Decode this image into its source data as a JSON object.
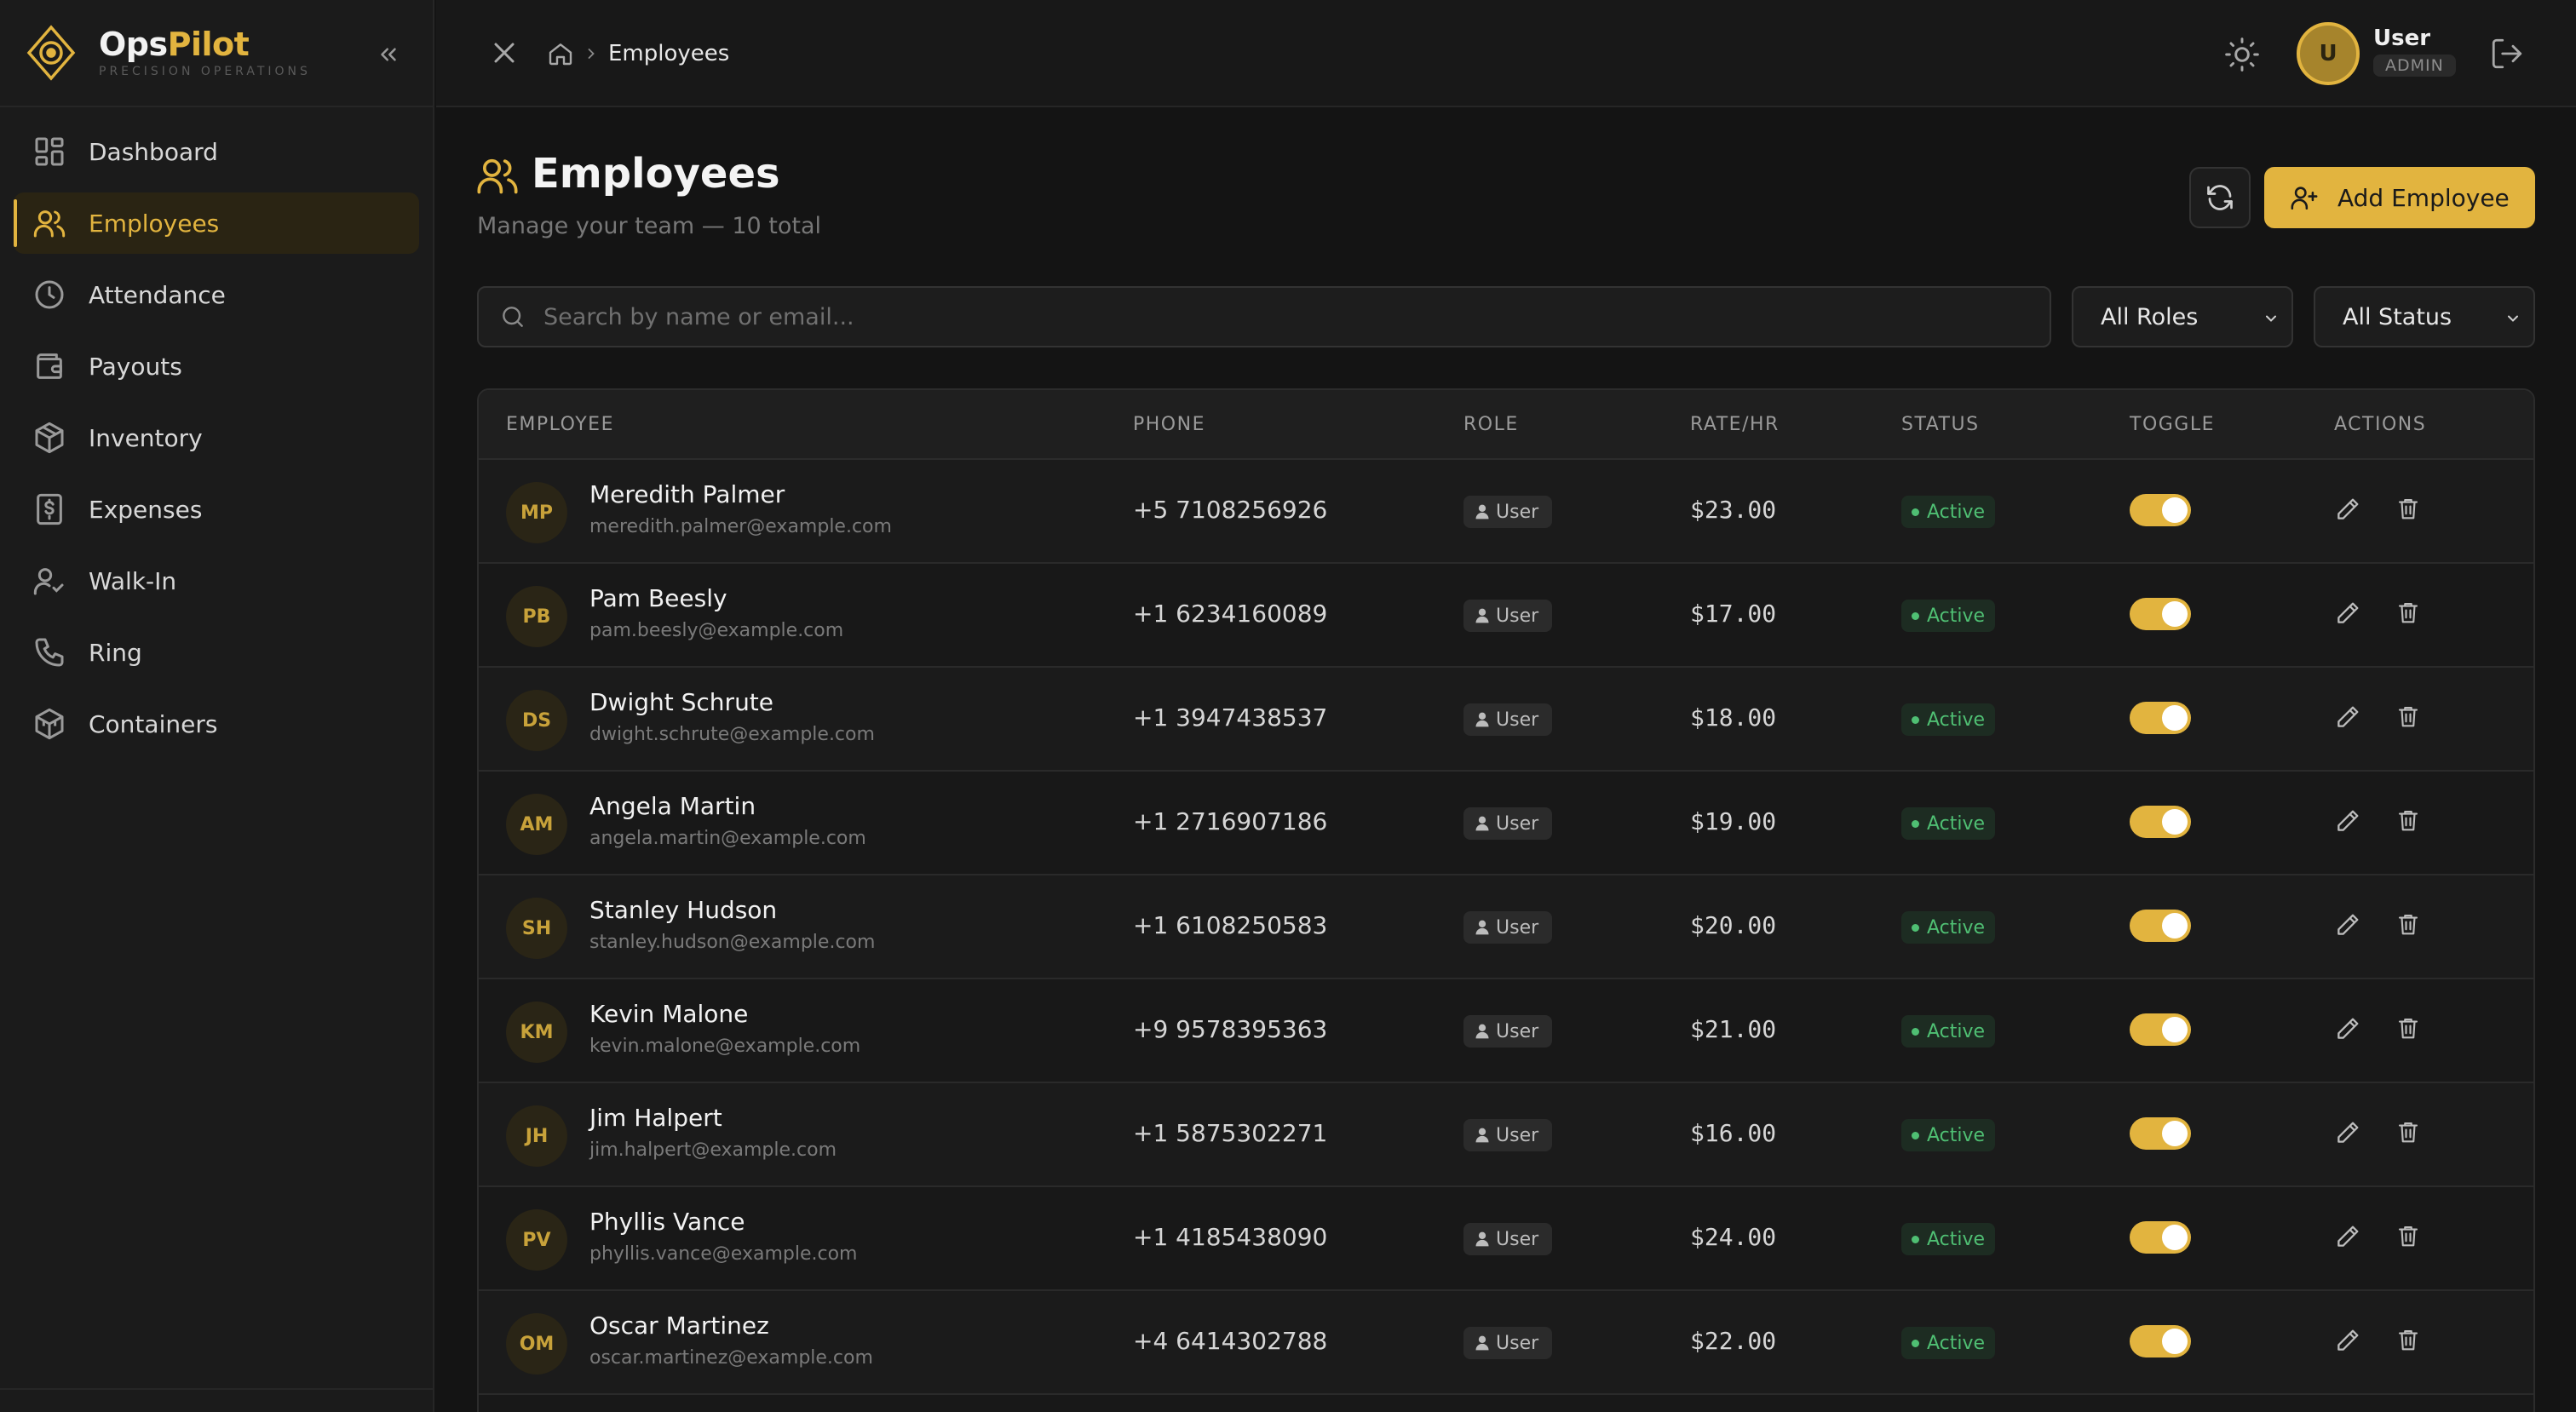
{
  "brand": {
    "name_part1": "Ops",
    "name_part2": "Pilot",
    "tagline": "PRECISION OPERATIONS",
    "accent_color": "#e2b43f",
    "logo_icon": "compass-diamond-icon"
  },
  "sidebar": {
    "collapse_icon": "chevrons-left-icon",
    "items": [
      {
        "label": "Dashboard",
        "icon": "dashboard-icon",
        "active": false
      },
      {
        "label": "Employees",
        "icon": "users-icon",
        "active": true
      },
      {
        "label": "Attendance",
        "icon": "clock-icon",
        "active": false
      },
      {
        "label": "Payouts",
        "icon": "wallet-icon",
        "active": false
      },
      {
        "label": "Inventory",
        "icon": "box-icon",
        "active": false
      },
      {
        "label": "Expenses",
        "icon": "receipt-dollar-icon",
        "active": false
      },
      {
        "label": "Walk-In",
        "icon": "user-check-icon",
        "active": false
      },
      {
        "label": "Ring",
        "icon": "phone-icon",
        "active": false
      },
      {
        "label": "Containers",
        "icon": "package-icon",
        "active": false
      }
    ]
  },
  "topbar": {
    "breadcrumb_current": "Employees",
    "user_initial": "U",
    "user_name": "User",
    "user_role": "ADMIN"
  },
  "page": {
    "title": "Employees",
    "subtitle": "Manage your team — 10 total",
    "add_button_label": "Add Employee"
  },
  "filters": {
    "search_placeholder": "Search by name or email...",
    "search_value": "",
    "roles_selected": "All Roles",
    "status_selected": "All Status"
  },
  "table": {
    "headers": {
      "employee": "EMPLOYEE",
      "phone": "PHONE",
      "role": "ROLE",
      "rate": "RATE/HR",
      "status": "STATUS",
      "toggle": "TOGGLE",
      "actions": "ACTIONS"
    },
    "rows": [
      {
        "initials": "MP",
        "name": "Meredith Palmer",
        "email": "meredith.palmer@example.com",
        "phone": "+5 7108256926",
        "role": "User",
        "rate": "$23.00",
        "status": "Active",
        "enabled": true
      },
      {
        "initials": "PB",
        "name": "Pam Beesly",
        "email": "pam.beesly@example.com",
        "phone": "+1 6234160089",
        "role": "User",
        "rate": "$17.00",
        "status": "Active",
        "enabled": true
      },
      {
        "initials": "DS",
        "name": "Dwight Schrute",
        "email": "dwight.schrute@example.com",
        "phone": "+1 3947438537",
        "role": "User",
        "rate": "$18.00",
        "status": "Active",
        "enabled": true
      },
      {
        "initials": "AM",
        "name": "Angela Martin",
        "email": "angela.martin@example.com",
        "phone": "+1 2716907186",
        "role": "User",
        "rate": "$19.00",
        "status": "Active",
        "enabled": true
      },
      {
        "initials": "SH",
        "name": "Stanley Hudson",
        "email": "stanley.hudson@example.com",
        "phone": "+1 6108250583",
        "role": "User",
        "rate": "$20.00",
        "status": "Active",
        "enabled": true
      },
      {
        "initials": "KM",
        "name": "Kevin Malone",
        "email": "kevin.malone@example.com",
        "phone": "+9 9578395363",
        "role": "User",
        "rate": "$21.00",
        "status": "Active",
        "enabled": true
      },
      {
        "initials": "JH",
        "name": "Jim Halpert",
        "email": "jim.halpert@example.com",
        "phone": "+1 5875302271",
        "role": "User",
        "rate": "$16.00",
        "status": "Active",
        "enabled": true
      },
      {
        "initials": "PV",
        "name": "Phyllis Vance",
        "email": "phyllis.vance@example.com",
        "phone": "+1 4185438090",
        "role": "User",
        "rate": "$24.00",
        "status": "Active",
        "enabled": true
      },
      {
        "initials": "OM",
        "name": "Oscar Martinez",
        "email": "oscar.martinez@example.com",
        "phone": "+4 6414302788",
        "role": "User",
        "rate": "$22.00",
        "status": "Active",
        "enabled": true
      }
    ]
  }
}
